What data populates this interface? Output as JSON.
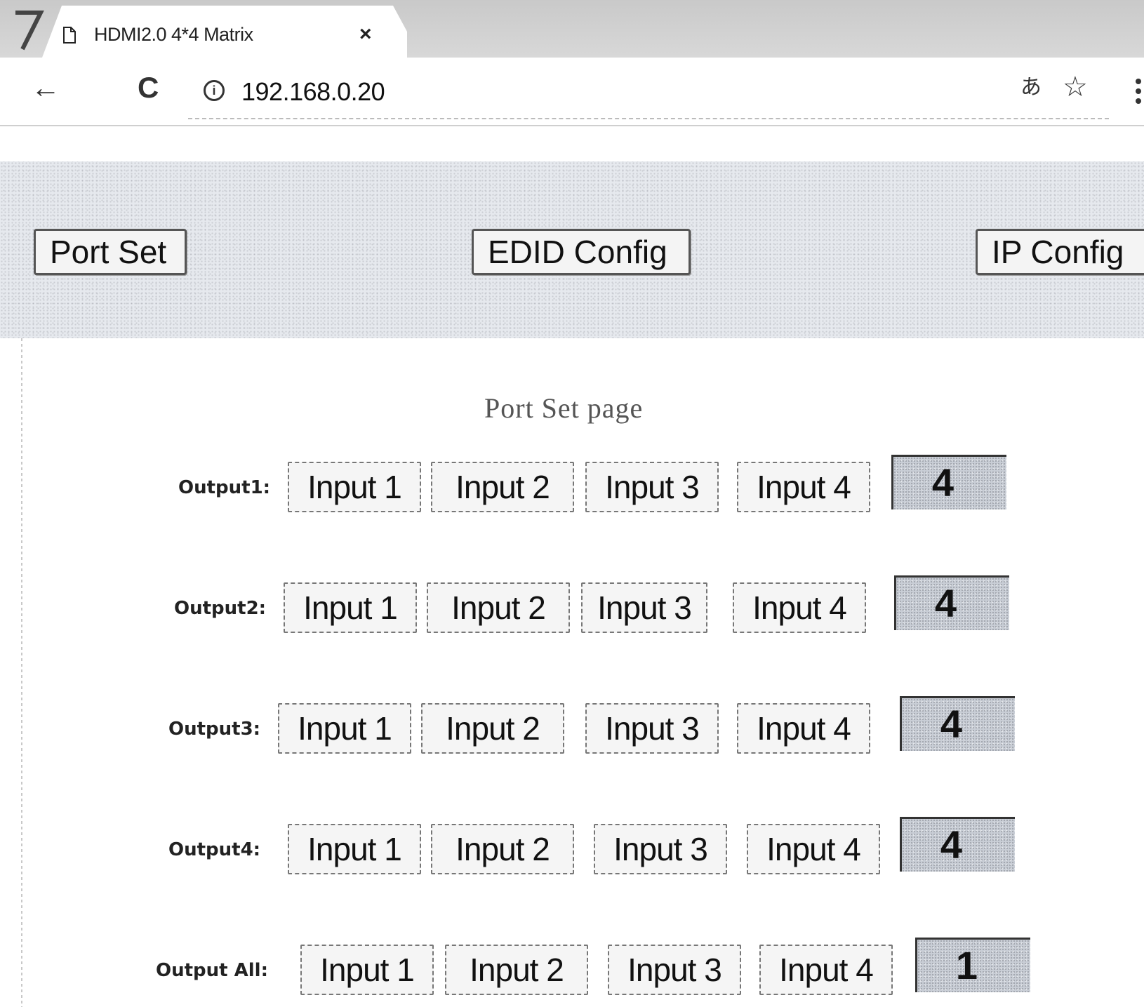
{
  "browser": {
    "tab_title": "HDMI2.0 4*4 Matrix",
    "tab_close": "×",
    "back_glyph": "←",
    "reload_glyph": "C",
    "info_glyph": "i",
    "url": "192.168.0.20",
    "translate_glyph": "あ",
    "star_glyph": "☆"
  },
  "nav": {
    "port_set": "Port Set",
    "edid_config": "EDID Config",
    "ip_config": "IP Config"
  },
  "page_heading": "Port Set page",
  "rows": [
    {
      "label": "Output1:",
      "inputs": [
        "Input 1",
        "Input 2",
        "Input 3",
        "Input 4"
      ],
      "selected": "4"
    },
    {
      "label": "Output2:",
      "inputs": [
        "Input 1",
        "Input 2",
        "Input 3",
        "Input 4"
      ],
      "selected": "4"
    },
    {
      "label": "Output3:",
      "inputs": [
        "Input 1",
        "Input 2",
        "Input 3",
        "Input 4"
      ],
      "selected": "4"
    },
    {
      "label": "Output4:",
      "inputs": [
        "Input 1",
        "Input 2",
        "Input 3",
        "Input 4"
      ],
      "selected": "4"
    },
    {
      "label": "Output All:",
      "inputs": [
        "Input 1",
        "Input 2",
        "Input 3",
        "Input 4"
      ],
      "selected": "1"
    }
  ]
}
